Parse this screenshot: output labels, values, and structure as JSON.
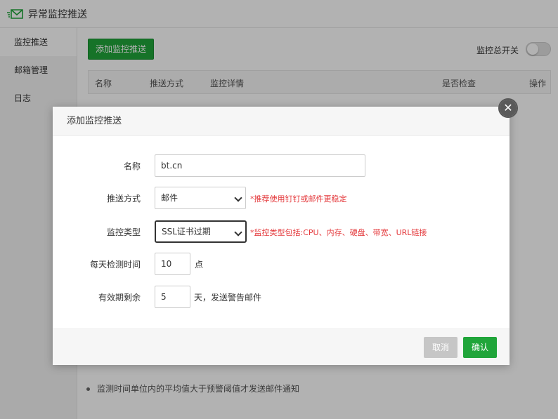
{
  "app": {
    "title": "异常监控推送"
  },
  "sidebar": {
    "items": [
      {
        "label": "监控推送",
        "active": true
      },
      {
        "label": "邮箱管理",
        "active": false
      },
      {
        "label": "日志",
        "active": false
      }
    ]
  },
  "main": {
    "add_button": "添加监控推送",
    "switch_label": "监控总开关",
    "switch_on": false,
    "table_headers": [
      "名称",
      "推送方式",
      "监控详情",
      "是否检查",
      "操作"
    ],
    "footnote": "监测时间单位内的平均值大于预警阈值才发送邮件通知"
  },
  "modal": {
    "title": "添加监控推送",
    "fields": {
      "name": {
        "label": "名称",
        "value": "bt.cn"
      },
      "push_method": {
        "label": "推送方式",
        "value": "邮件",
        "hint": "*推荐使用钉钉或邮件更稳定"
      },
      "monitor_type": {
        "label": "监控类型",
        "value": "SSL证书过期",
        "hint": "*监控类型包括:CPU、内存、硬盘、带宽、URL链接"
      },
      "daily_time": {
        "label": "每天检测时间",
        "value": "10",
        "unit": "点"
      },
      "remaining": {
        "label": "有效期剩余",
        "value": "5",
        "unit": "天，发送警告邮件"
      }
    },
    "cancel_label": "取消",
    "confirm_label": "确认"
  },
  "colors": {
    "accent": "#20a53a",
    "hint": "#e4393c",
    "cancel": "#c6c6c6"
  }
}
